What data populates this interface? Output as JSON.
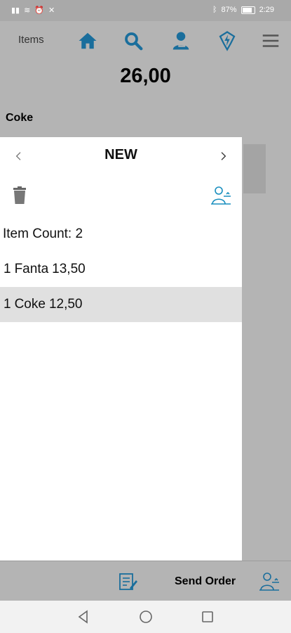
{
  "status_bar": {
    "signal_icons": "📶 📶 ≋ ⏰ ✕",
    "battery_text": "87%",
    "time": "2:29"
  },
  "nav": {
    "title": "Items",
    "icons": [
      "home-icon",
      "search-icon",
      "user-icon",
      "lightning-badge-icon",
      "menu-icon"
    ],
    "accent_color": "#1a6e9c"
  },
  "total": "26,00",
  "current_item": "Coke",
  "panel": {
    "title": "NEW",
    "item_count_label": "Item Count:",
    "item_count_value": "2",
    "orders": [
      {
        "qty": "1",
        "name": "Fanta",
        "price": "13,50",
        "selected": false
      },
      {
        "qty": "1",
        "name": "Coke",
        "price": "12,50",
        "selected": true
      }
    ]
  },
  "bottom_bar": {
    "send_order_label": "Send Order"
  }
}
